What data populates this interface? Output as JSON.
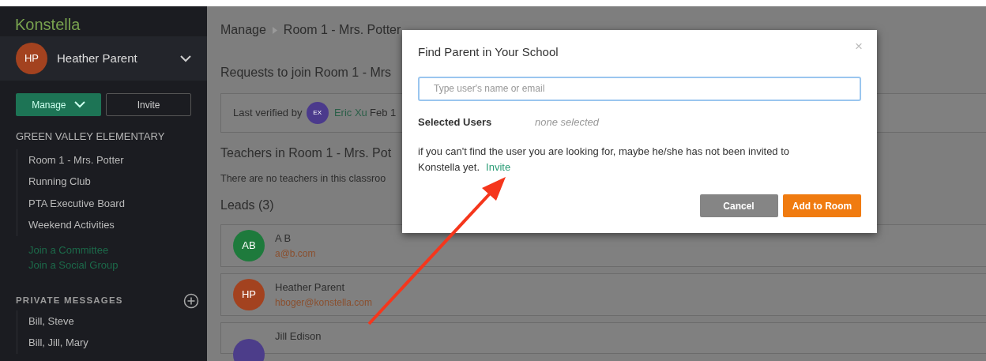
{
  "sidebar": {
    "logo": "Konstella",
    "user": {
      "initials": "HP",
      "name": "Heather Parent"
    },
    "buttons": [
      {
        "label": "Manage",
        "kind": "dropdown"
      },
      {
        "label": "Invite",
        "kind": "outline"
      }
    ],
    "school": "GREEN VALLEY ELEMENTARY",
    "groups": [
      {
        "label": "Room 1 - Mrs. Potter"
      },
      {
        "label": "Running Club"
      },
      {
        "label": "PTA Executive Board"
      },
      {
        "label": "Weekend Activities"
      }
    ],
    "links": [
      "Join a Committee",
      "Join a Social Group"
    ],
    "messages_heading": "PRIVATE MESSAGES",
    "messages": [
      "Bill, Steve",
      "Bill, Jill, Mary"
    ]
  },
  "main": {
    "breadcrumb": [
      "Manage",
      "Room 1 - Mrs. Potter"
    ],
    "requests_heading": "Requests to join Room 1 - Mrs",
    "verified": {
      "prefix": "Last verified by",
      "initials": "EX",
      "name": "Eric Xu",
      "date": "Feb 1"
    },
    "teachers_heading": "Teachers in Room 1 - Mrs. Pot",
    "teachers_note": "There are no teachers in this classroo",
    "leads_heading": "Leads (3)",
    "leads": [
      {
        "initials": "AB",
        "name": "A B",
        "email": "a@b.com",
        "color": "#1e7a3c"
      },
      {
        "initials": "HP",
        "name": "Heather Parent",
        "email": "hboger@konstella.com",
        "color": "#a3421f"
      },
      {
        "name": "Jill Edison",
        "color": "#4c3d8a"
      }
    ]
  },
  "modal": {
    "title": "Find Parent in Your School",
    "close": "×",
    "search": {
      "placeholder": "Type user's name or email"
    },
    "selected_label": "Selected Users",
    "selected_value": "none selected",
    "note": "if you can't find the user you are looking for, maybe he/she has not been invited to Konstella yet.",
    "invite_link": "Invite",
    "buttons": [
      {
        "label": "Cancel",
        "kind": "secondary"
      },
      {
        "label": "Add to Room",
        "kind": "primary"
      }
    ]
  }
}
